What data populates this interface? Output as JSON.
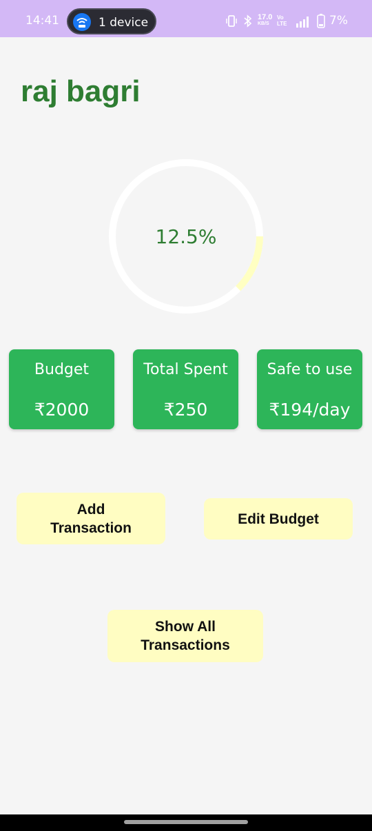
{
  "status_bar": {
    "time": "14:41",
    "hotspot_label": "1 device",
    "network_speed": "17.0",
    "network_unit": "KB/S",
    "volte": "Vo LTE",
    "battery": "7%"
  },
  "user": {
    "name": "raj bagri"
  },
  "progress": {
    "percent_text": "12.5%",
    "fraction": 0.125,
    "track_color": "#ffffff",
    "fill_color": "#ffffc2"
  },
  "stats": [
    {
      "label": "Budget",
      "value": "₹2000"
    },
    {
      "label": "Total Spent",
      "value": "₹250"
    },
    {
      "label": "Safe to use",
      "value": "₹194/day"
    }
  ],
  "actions": {
    "add_transaction": "Add Transaction",
    "edit_budget": "Edit Budget",
    "show_all": "Show All Transactions"
  },
  "colors": {
    "accent_green": "#2e7d32",
    "card_green": "#2db559",
    "button_yellow": "#fffdc2",
    "status_bar": "#d3b8f6"
  }
}
